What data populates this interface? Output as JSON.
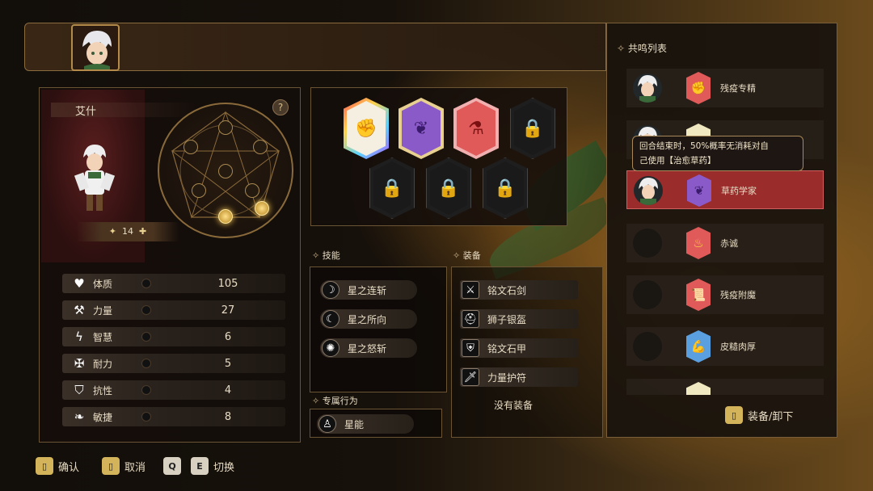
{
  "hero": {
    "name": "艾什",
    "level": "14",
    "help_label": "?"
  },
  "stats": [
    {
      "label": "体质",
      "value": "105",
      "icon": "heart-icon"
    },
    {
      "label": "力量",
      "value": "27",
      "icon": "axe-icon"
    },
    {
      "label": "智慧",
      "value": "6",
      "icon": "lightning-icon"
    },
    {
      "label": "耐力",
      "value": "5",
      "icon": "endurance-icon"
    },
    {
      "label": "抗性",
      "value": "4",
      "icon": "shield-bolt-icon"
    },
    {
      "label": "敏捷",
      "value": "8",
      "icon": "wing-icon"
    }
  ],
  "sections": {
    "skills": "技能",
    "equipment": "装备",
    "exclusive": "专属行为",
    "resonance_list": "共鸣列表"
  },
  "skills": [
    {
      "label": "星之连斩",
      "icon": "crescent-slash-icon"
    },
    {
      "label": "星之所向",
      "icon": "crescent-moon-icon"
    },
    {
      "label": "星之怒斩",
      "icon": "spiked-ring-icon"
    }
  ],
  "exclusive_action": {
    "label": "星能",
    "icon": "hero-silhouette-icon"
  },
  "equipment": [
    {
      "label": "铭文石剑",
      "icon": "sword-icon"
    },
    {
      "label": "狮子银盔",
      "icon": "helmet-icon"
    },
    {
      "label": "铭文石甲",
      "icon": "armor-icon"
    },
    {
      "label": "力量护符",
      "icon": "dagger-icon"
    }
  ],
  "equipment_empty": "没有装备",
  "resonance": [
    {
      "label": "残疫专精",
      "icon": "arm-icon",
      "selected": false
    },
    {
      "label": "",
      "icon": "card-icon",
      "selected": false
    },
    {
      "label": "草药学家",
      "icon": "herb-leaf-icon",
      "selected": true
    },
    {
      "label": "赤诚",
      "icon": "flame-icon",
      "selected": false
    },
    {
      "label": "残疫附魔",
      "icon": "scroll-icon",
      "selected": false
    },
    {
      "label": "皮糙肉厚",
      "icon": "flex-arm-icon",
      "selected": false
    }
  ],
  "tooltip": {
    "line1": "回合结束时，50%概率无消耗对自",
    "line2": "己使用【治愈草药】"
  },
  "buttons": {
    "equip_unequip": "装备/卸下",
    "confirm": "确认",
    "cancel": "取消",
    "switch": "切换",
    "key_q": "Q",
    "key_e": "E"
  },
  "colors": {
    "accent_gold": "#d4b45a",
    "selected_red": "#9a2c2c",
    "purple_card": "#8a5ac8",
    "red_card": "#e05a5a"
  }
}
